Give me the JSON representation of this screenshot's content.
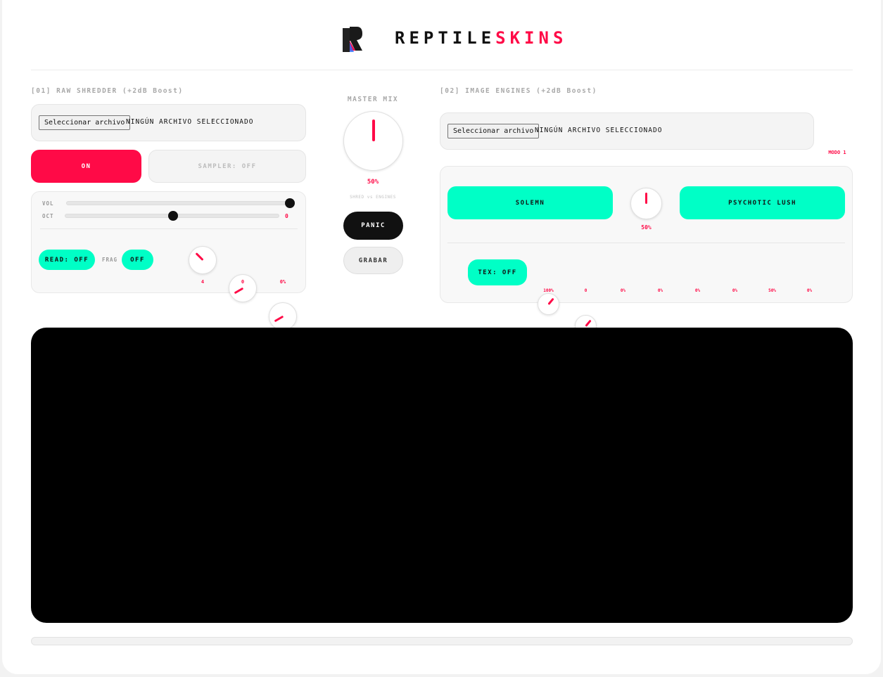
{
  "brand": {
    "part1": "REPTILE",
    "part2": "SKINS"
  },
  "colors": {
    "accent": "#ff0a47",
    "teal": "#00ffc6",
    "dark": "#111111"
  },
  "shredder": {
    "label": "[01] RAW SHREDDER (+2dB Boost)",
    "file_button": "Seleccionar archivo",
    "file_status": "NINGÚN ARCHIVO SELECCIONADO",
    "on_button": "ON",
    "sampler_button": "SAMPLER: OFF",
    "vol_label": "VOL",
    "vol_value": 1.0,
    "oct_label": "OCT",
    "oct_value": "0",
    "oct_position": 0.5,
    "read_button": "READ: OFF",
    "frag_label": "FRAG",
    "frag_button": "OFF",
    "knobs": [
      {
        "value": "4",
        "angle": -45
      },
      {
        "value": "0",
        "angle": -120
      },
      {
        "value": "0%",
        "angle": -120
      }
    ]
  },
  "master": {
    "label": "MASTER MIX",
    "value": "50%",
    "angle": 0,
    "sublabel": "SHRED vs ENGINES",
    "panic_button": "PANIC",
    "record_button": "GRABAR"
  },
  "engines": {
    "label": "[02] IMAGE ENGINES (+2dB Boost)",
    "file_button": "Seleccionar archivo",
    "file_status": "NINGÚN ARCHIVO SELECCIONADO",
    "mode_label": "MODO 1",
    "mode_angle": -120,
    "solemn_button": "SOLEMN",
    "lush_button": "PSYCHOTIC LUSH",
    "blend_value": "50%",
    "blend_angle": 0,
    "tex_button": "TEX: OFF",
    "knobs": [
      {
        "value": "100%",
        "angle": 40
      },
      {
        "value": "0",
        "angle": 40
      },
      {
        "value": "0%",
        "angle": -120
      },
      {
        "value": "0%",
        "angle": -120
      },
      {
        "value": "0%",
        "angle": -120
      },
      {
        "value": "0%",
        "angle": -120
      },
      {
        "value": "50%",
        "angle": 0
      },
      {
        "value": "0%",
        "angle": -120
      }
    ]
  }
}
